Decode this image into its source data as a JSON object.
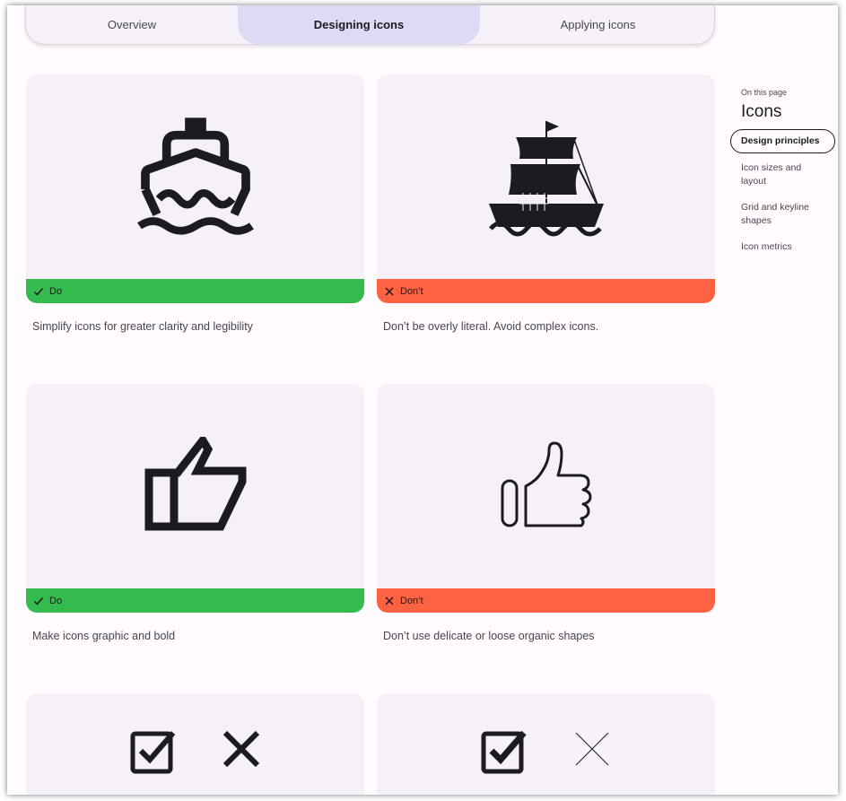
{
  "tabs": [
    {
      "label": "Overview"
    },
    {
      "label": "Designing icons"
    },
    {
      "label": "Applying icons"
    }
  ],
  "cards": [
    {
      "status": "Do",
      "caption": "Simplify icons for greater clarity and legibility"
    },
    {
      "status": "Don’t",
      "caption": "Don’t be overly literal. Avoid complex icons."
    },
    {
      "status": "Do",
      "caption": "Make icons graphic and bold"
    },
    {
      "status": "Don’t",
      "caption": "Don’t use delicate or loose organic shapes"
    }
  ],
  "toc": {
    "small_label": "On this page",
    "title": "Icons",
    "items": [
      {
        "label": "Design principles"
      },
      {
        "label": "Icon sizes and layout"
      },
      {
        "label": "Grid and keyline shapes"
      },
      {
        "label": "Icon metrics"
      }
    ]
  },
  "colors": {
    "do": "#33bb4e",
    "dont": "#ff6240",
    "active_tab": "#dcdaf5",
    "card_bg": "#f6f1f8"
  }
}
